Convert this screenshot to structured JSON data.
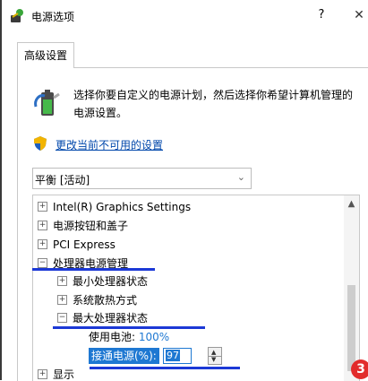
{
  "window": {
    "title": "电源选项",
    "help_label": "?",
    "close_label": "✕"
  },
  "tab": {
    "label": "高级设置"
  },
  "description": "选择你要自定义的电源计划，然后选择你希望计算机管理的电源设置。",
  "change_link": "更改当前不可用的设置",
  "scheme": {
    "selected": "平衡 [活动]"
  },
  "tree": {
    "items": [
      {
        "label": "Intel(R) Graphics Settings",
        "expander": "+"
      },
      {
        "label": "电源按钮和盖子",
        "expander": "+"
      },
      {
        "label": "PCI Express",
        "expander": "+"
      },
      {
        "label": "处理器电源管理",
        "expander": "−"
      },
      {
        "label": "最小处理器状态",
        "expander": "+"
      },
      {
        "label": "系统散热方式",
        "expander": "+"
      },
      {
        "label": "最大处理器状态",
        "expander": "−"
      },
      {
        "label": "显示",
        "expander": "+"
      }
    ],
    "battery_label": "使用电池:",
    "battery_value": "100%",
    "plugged_label": "接通电源(%):",
    "plugged_value": "97"
  },
  "badge": "3",
  "colors": {
    "link": "#0047ab",
    "selection": "#1e78d2",
    "annotation_underline": "#1c39d6",
    "badge": "#e22b2b"
  }
}
